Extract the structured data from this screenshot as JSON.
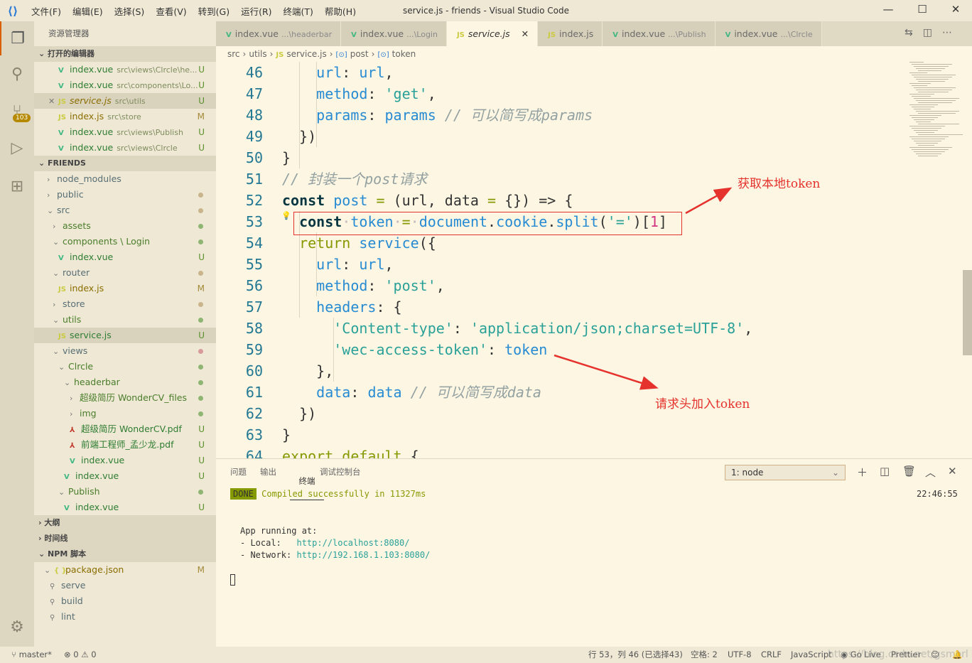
{
  "titlebar": {
    "title": "service.js - friends - Visual Studio Code",
    "menus": [
      "文件(F)",
      "编辑(E)",
      "选择(S)",
      "查看(V)",
      "转到(G)",
      "运行(R)",
      "终端(T)",
      "帮助(H)"
    ]
  },
  "activity": {
    "badge": "103"
  },
  "sidebar": {
    "title": "资源管理器",
    "open_editors_header": "打开的编辑器",
    "open_editors": [
      {
        "icon": "vue",
        "label": "index.vue",
        "desc": "src\\views\\Clrcle\\he...",
        "status": "U"
      },
      {
        "icon": "vue",
        "label": "index.vue",
        "desc": "src\\components\\Lo...",
        "status": "U"
      },
      {
        "icon": "js",
        "label": "service.js",
        "desc": "src\\utils",
        "status": "U",
        "selected": true,
        "italic": true
      },
      {
        "icon": "js",
        "label": "index.js",
        "desc": "src\\store",
        "status": "M"
      },
      {
        "icon": "vue",
        "label": "index.vue",
        "desc": "src\\views\\Publish",
        "status": "U"
      },
      {
        "icon": "vue",
        "label": "index.vue",
        "desc": "src\\views\\Clrcle",
        "status": "U"
      }
    ],
    "project_header": "FRIENDS",
    "tree": [
      {
        "level": 0,
        "chev": "›",
        "label": "node_modules"
      },
      {
        "level": 0,
        "chev": "›",
        "label": "public",
        "dot": "#c9b48c"
      },
      {
        "level": 0,
        "chev": "⌄",
        "label": "src",
        "dot": "#c9b48c"
      },
      {
        "level": 1,
        "chev": "›",
        "label": "assets",
        "dot": "#8fb573"
      },
      {
        "level": 1,
        "chev": "⌄",
        "label": "components \\ Login",
        "dot": "#8fb573"
      },
      {
        "level": 2,
        "icon": "vue",
        "label": "index.vue",
        "status": "U"
      },
      {
        "level": 1,
        "chev": "⌄",
        "label": "router",
        "dot": "#c9b48c"
      },
      {
        "level": 2,
        "icon": "js",
        "label": "index.js",
        "status": "M"
      },
      {
        "level": 1,
        "chev": "›",
        "label": "store",
        "dot": "#c9b48c"
      },
      {
        "level": 1,
        "chev": "⌄",
        "label": "utils",
        "dot": "#8fb573"
      },
      {
        "level": 2,
        "icon": "js",
        "label": "service.js",
        "status": "U",
        "selected": true
      },
      {
        "level": 1,
        "chev": "⌄",
        "label": "views",
        "dot": "#d89a9a"
      },
      {
        "level": 2,
        "chev": "⌄",
        "label": "Clrcle",
        "dot": "#8fb573"
      },
      {
        "level": 3,
        "chev": "⌄",
        "label": "headerbar",
        "dot": "#8fb573"
      },
      {
        "level": 4,
        "chev": "›",
        "label": "超级简历 WonderCV_files",
        "dot": "#8fb573"
      },
      {
        "level": 4,
        "chev": "›",
        "label": "img",
        "dot": "#8fb573"
      },
      {
        "level": 4,
        "icon": "pdf",
        "label": "超级简历 WonderCV.pdf",
        "status": "U"
      },
      {
        "level": 4,
        "icon": "pdf",
        "label": "前端工程师_孟少龙.pdf",
        "status": "U"
      },
      {
        "level": 4,
        "icon": "vue",
        "label": "index.vue",
        "status": "U"
      },
      {
        "level": 3,
        "icon": "vue",
        "label": "index.vue",
        "status": "U"
      },
      {
        "level": 2,
        "chev": "⌄",
        "label": "Publish",
        "dot": "#8fb573"
      },
      {
        "level": 3,
        "icon": "vue",
        "label": "index.vue",
        "status": "U"
      }
    ],
    "outline_header": "大纲",
    "timeline_header": "时间线",
    "npm_header": "NPM 脚本",
    "npm": [
      {
        "level": 0,
        "chev": "⌄",
        "icon": "json",
        "label": "package.json",
        "status": "M"
      },
      {
        "level": 1,
        "icon": "wr",
        "label": "serve"
      },
      {
        "level": 1,
        "icon": "wr",
        "label": "build"
      },
      {
        "level": 1,
        "icon": "wr",
        "label": "lint"
      }
    ]
  },
  "tabs": [
    {
      "icon": "vue",
      "label": "index.vue",
      "desc": "...\\headerbar"
    },
    {
      "icon": "vue",
      "label": "index.vue",
      "desc": "...\\Login"
    },
    {
      "icon": "js",
      "label": "service.js",
      "desc": "",
      "active": true,
      "close": "✕"
    },
    {
      "icon": "js",
      "label": "index.js",
      "desc": ""
    },
    {
      "icon": "vue",
      "label": "index.vue",
      "desc": "...\\Publish"
    },
    {
      "icon": "vue",
      "label": "index.vue",
      "desc": "...\\Clrcle"
    }
  ],
  "breadcrumb": [
    "src",
    "utils",
    "service.js",
    "post",
    "token"
  ],
  "code": [
    {
      "n": "46",
      "t": [
        [
          "pn",
          "    "
        ],
        [
          "id",
          "url"
        ],
        [
          "pn",
          ": "
        ],
        [
          "id",
          "url"
        ],
        [
          "pn",
          ","
        ]
      ]
    },
    {
      "n": "47",
      "t": [
        [
          "pn",
          "    "
        ],
        [
          "id",
          "method"
        ],
        [
          "pn",
          ": "
        ],
        [
          "str",
          "'get'"
        ],
        [
          "pn",
          ","
        ]
      ]
    },
    {
      "n": "48",
      "t": [
        [
          "pn",
          "    "
        ],
        [
          "id",
          "params"
        ],
        [
          "pn",
          ": "
        ],
        [
          "id",
          "params"
        ],
        [
          "cm",
          " // 可以简写成params"
        ]
      ]
    },
    {
      "n": "49",
      "t": [
        [
          "pn",
          "  })"
        ]
      ]
    },
    {
      "n": "50",
      "t": [
        [
          "pn",
          "}"
        ]
      ]
    },
    {
      "n": "51",
      "t": [
        [
          "cm",
          "// 封装一个post请求"
        ]
      ]
    },
    {
      "n": "52",
      "t": [
        [
          "kw",
          "const "
        ],
        [
          "id",
          "post"
        ],
        [
          "op",
          " = "
        ],
        [
          "pn",
          "(url, data "
        ],
        [
          "op",
          "="
        ],
        [
          "pn",
          " {}) => {"
        ]
      ]
    },
    {
      "n": "53",
      "t": [
        [
          "pn",
          "  "
        ],
        [
          "kw",
          "const"
        ],
        [
          "ws",
          "·"
        ],
        [
          "id",
          "token"
        ],
        [
          "ws",
          "·"
        ],
        [
          "op",
          "="
        ],
        [
          "ws",
          "·"
        ],
        [
          "id",
          "document"
        ],
        [
          "pn",
          "."
        ],
        [
          "id",
          "cookie"
        ],
        [
          "pn",
          "."
        ],
        [
          "id",
          "split"
        ],
        [
          "pn",
          "("
        ],
        [
          "str",
          "'='"
        ],
        [
          "pn",
          ")["
        ],
        [
          "num",
          "1"
        ],
        [
          "pn",
          "]"
        ]
      ]
    },
    {
      "n": "54",
      "t": [
        [
          "pn",
          "  "
        ],
        [
          "kw2",
          "return "
        ],
        [
          "id",
          "service"
        ],
        [
          "pn",
          "({"
        ]
      ]
    },
    {
      "n": "55",
      "t": [
        [
          "pn",
          "    "
        ],
        [
          "id",
          "url"
        ],
        [
          "pn",
          ": "
        ],
        [
          "id",
          "url"
        ],
        [
          "pn",
          ","
        ]
      ]
    },
    {
      "n": "56",
      "t": [
        [
          "pn",
          "    "
        ],
        [
          "id",
          "method"
        ],
        [
          "pn",
          ": "
        ],
        [
          "str",
          "'post'"
        ],
        [
          "pn",
          ","
        ]
      ]
    },
    {
      "n": "57",
      "t": [
        [
          "pn",
          "    "
        ],
        [
          "id",
          "headers"
        ],
        [
          "pn",
          ": {"
        ]
      ]
    },
    {
      "n": "58",
      "t": [
        [
          "pn",
          "      "
        ],
        [
          "str",
          "'Content-type'"
        ],
        [
          "pn",
          ": "
        ],
        [
          "str",
          "'application/json;charset=UTF-8'"
        ],
        [
          "pn",
          ","
        ]
      ]
    },
    {
      "n": "59",
      "t": [
        [
          "pn",
          "      "
        ],
        [
          "str",
          "'wec-access-token'"
        ],
        [
          "pn",
          ": "
        ],
        [
          "id",
          "token"
        ]
      ]
    },
    {
      "n": "60",
      "t": [
        [
          "pn",
          "    },"
        ]
      ]
    },
    {
      "n": "61",
      "t": [
        [
          "pn",
          "    "
        ],
        [
          "id",
          "data"
        ],
        [
          "pn",
          ": "
        ],
        [
          "id",
          "data"
        ],
        [
          "cm",
          " // 可以简写成data"
        ]
      ]
    },
    {
      "n": "62",
      "t": [
        [
          "pn",
          "  })"
        ]
      ]
    },
    {
      "n": "63",
      "t": [
        [
          "pn",
          "}"
        ]
      ]
    },
    {
      "n": "64",
      "t": [
        [
          "kw2",
          "export default "
        ],
        [
          "pn",
          "{"
        ]
      ]
    }
  ],
  "annotations": {
    "a1": "获取本地token",
    "a2": "请求头加入token"
  },
  "panel": {
    "tabs": [
      "问题",
      "输出",
      "终端",
      "调试控制台"
    ],
    "active": "终端",
    "terminal_select": "1: node",
    "done": "DONE",
    "compiled": "Compiled successfully in 11327ms",
    "time": "22:46:55",
    "running": "App running at:",
    "local_label": "- Local:   ",
    "local_url": "http://localhost:8080/",
    "network_label": "- Network: ",
    "network_url": "http://192.168.1.103:8080/"
  },
  "statusbar": {
    "branch": "master*",
    "errors": "0",
    "warnings": "0",
    "position": "行 53，列 46 (已选择43)",
    "spaces": "空格: 2",
    "encoding": "UTF-8",
    "eol": "CRLF",
    "language": "JavaScript",
    "golive": "Go Live",
    "prettier": "Prettier",
    "watermark": "https://blog.csdn.net/gsmorl"
  },
  "colors": {
    "editor_bg": "#fdf6e3",
    "sidebar_bg": "#eee8d5",
    "activity_bg": "#ddd6c1",
    "accent": "#268bd2",
    "annotation": "#e5322d",
    "done_badge": "#859900"
  }
}
